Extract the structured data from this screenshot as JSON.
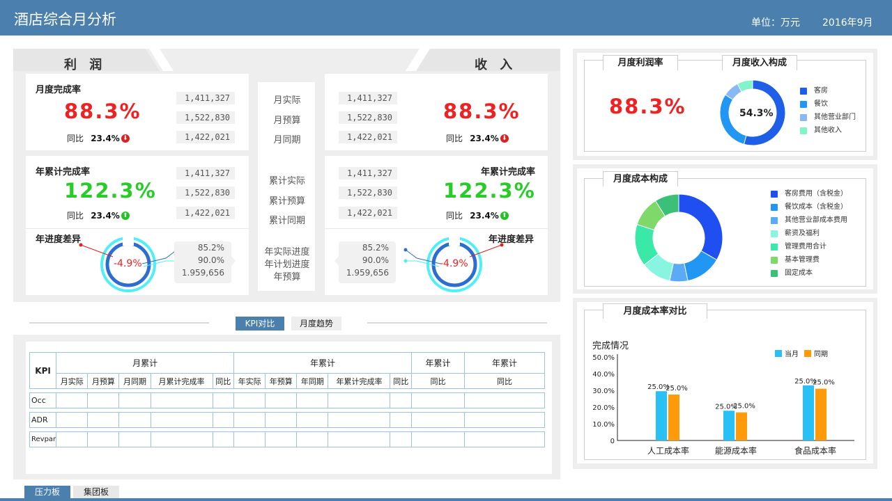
{
  "header": {
    "title": "酒店综合月分析",
    "unit": "单位：万元",
    "date": "2016年9月"
  },
  "profit": {
    "tab": "利 润",
    "monthly": {
      "label": "月度完成率",
      "value": "88.3%",
      "yoy_label": "同比",
      "yoy": "23.4%",
      "trend": "down"
    },
    "annual": {
      "label": "年累计完成率",
      "value": "122.3%",
      "yoy_label": "同比",
      "yoy": "23.4%",
      "trend": "up"
    },
    "progress": {
      "label": "年进度差异",
      "diff": "-4.9%",
      "values": [
        "85.2%",
        "90.0%",
        "1.959,656"
      ]
    },
    "pills_month": [
      "1,411,327",
      "1,522,830",
      "1,422,021"
    ],
    "pills_year": [
      "1,411,327",
      "1,522,830",
      "1,422,021"
    ]
  },
  "income": {
    "tab": "收 入",
    "monthly": {
      "value": "88.3%",
      "yoy_label": "同比",
      "yoy": "23.4%",
      "trend": "down"
    },
    "annual": {
      "label": "年累计完成率",
      "value": "122.3%",
      "yoy_label": "同比",
      "yoy": "23.4%",
      "trend": "up"
    },
    "progress": {
      "label": "年进度差异",
      "diff": "-4.9%",
      "values": [
        "85.2%",
        "90.0%",
        "1.959,656"
      ]
    },
    "pills_month": [
      "1,411,327",
      "1,522,830",
      "1,422,021"
    ],
    "pills_year": [
      "1,411,327",
      "1,522,830",
      "1,422,021"
    ]
  },
  "middle": {
    "month": [
      "月实际",
      "月预算",
      "月同期"
    ],
    "cum": [
      "累计实际",
      "累计预算",
      "累计同期"
    ],
    "progress": [
      "年实际进度",
      "年计划进度",
      "年预算"
    ]
  },
  "switch": {
    "active": "KPI对比",
    "inactive": "月度趋势"
  },
  "kpi_table": {
    "corner": "KPI",
    "groups": [
      "月累计",
      "年累计",
      "年累计",
      "年累计"
    ],
    "sub": [
      "月实际",
      "月预算",
      "月同期",
      "月累计完成率",
      "同比",
      "年实际",
      "年预算",
      "年同期",
      "年累计完成率",
      "同比",
      "同比",
      "同比"
    ],
    "rows": [
      "Occ",
      "ADR",
      "Revpar"
    ]
  },
  "profit_rate": {
    "title": "月度利润率",
    "value": "88.3%"
  },
  "income_comp": {
    "title": "月度收入构成",
    "center": "54.3%",
    "legend": [
      "客房",
      "餐饮",
      "其他营业部门",
      "其他收入"
    ],
    "colors": [
      "#1f5fe8",
      "#2196f3",
      "#8ab8f5",
      "#7ff5c8"
    ],
    "values": [
      54.3,
      30,
      8,
      7.7
    ]
  },
  "cost_comp": {
    "title": "月度成本构成",
    "legend": [
      "客房费用（含税金）",
      "餐饮成本（含税金）",
      "其他营业部成本费用",
      "薪资及福利",
      "管理费用合计",
      "基本管理费",
      "固定成本"
    ],
    "colors": [
      "#1f4ff0",
      "#2196f3",
      "#5aaaf5",
      "#88f5e0",
      "#3ae8a8",
      "#7ed86a",
      "#3cc078"
    ],
    "values": [
      30,
      12,
      6,
      10,
      14,
      10,
      8
    ]
  },
  "cost_rate": {
    "title": "月度成本率对比",
    "subtitle": "完成情况",
    "legend": [
      "当月",
      "同期"
    ],
    "colors": [
      "#29c1f5",
      "#ff9a0a"
    ]
  },
  "chart_data": {
    "type": "bar",
    "title": "完成情况",
    "categories": [
      "人工成本率",
      "能源成本率",
      "食品成本率"
    ],
    "series": [
      {
        "name": "当月",
        "values": [
          25.0,
          25.0,
          25.0
        ],
        "plotted": [
          29.5,
          17.8,
          33
        ]
      },
      {
        "name": "同期",
        "values": [
          25.0,
          25.0,
          25.0
        ],
        "plotted": [
          27.5,
          16.8,
          31
        ]
      }
    ],
    "data_labels": [
      "25.0%",
      "25.0%",
      "25.0%",
      "25.0%",
      "25.0%",
      "25.0%"
    ],
    "y_ticks": [
      "50.0%",
      "40.0%",
      "30.0%",
      "20.0%",
      "10.0%",
      "0"
    ],
    "ylim": [
      0,
      50
    ]
  },
  "footer": {
    "tabs": [
      "压力板",
      "集团板"
    ]
  }
}
